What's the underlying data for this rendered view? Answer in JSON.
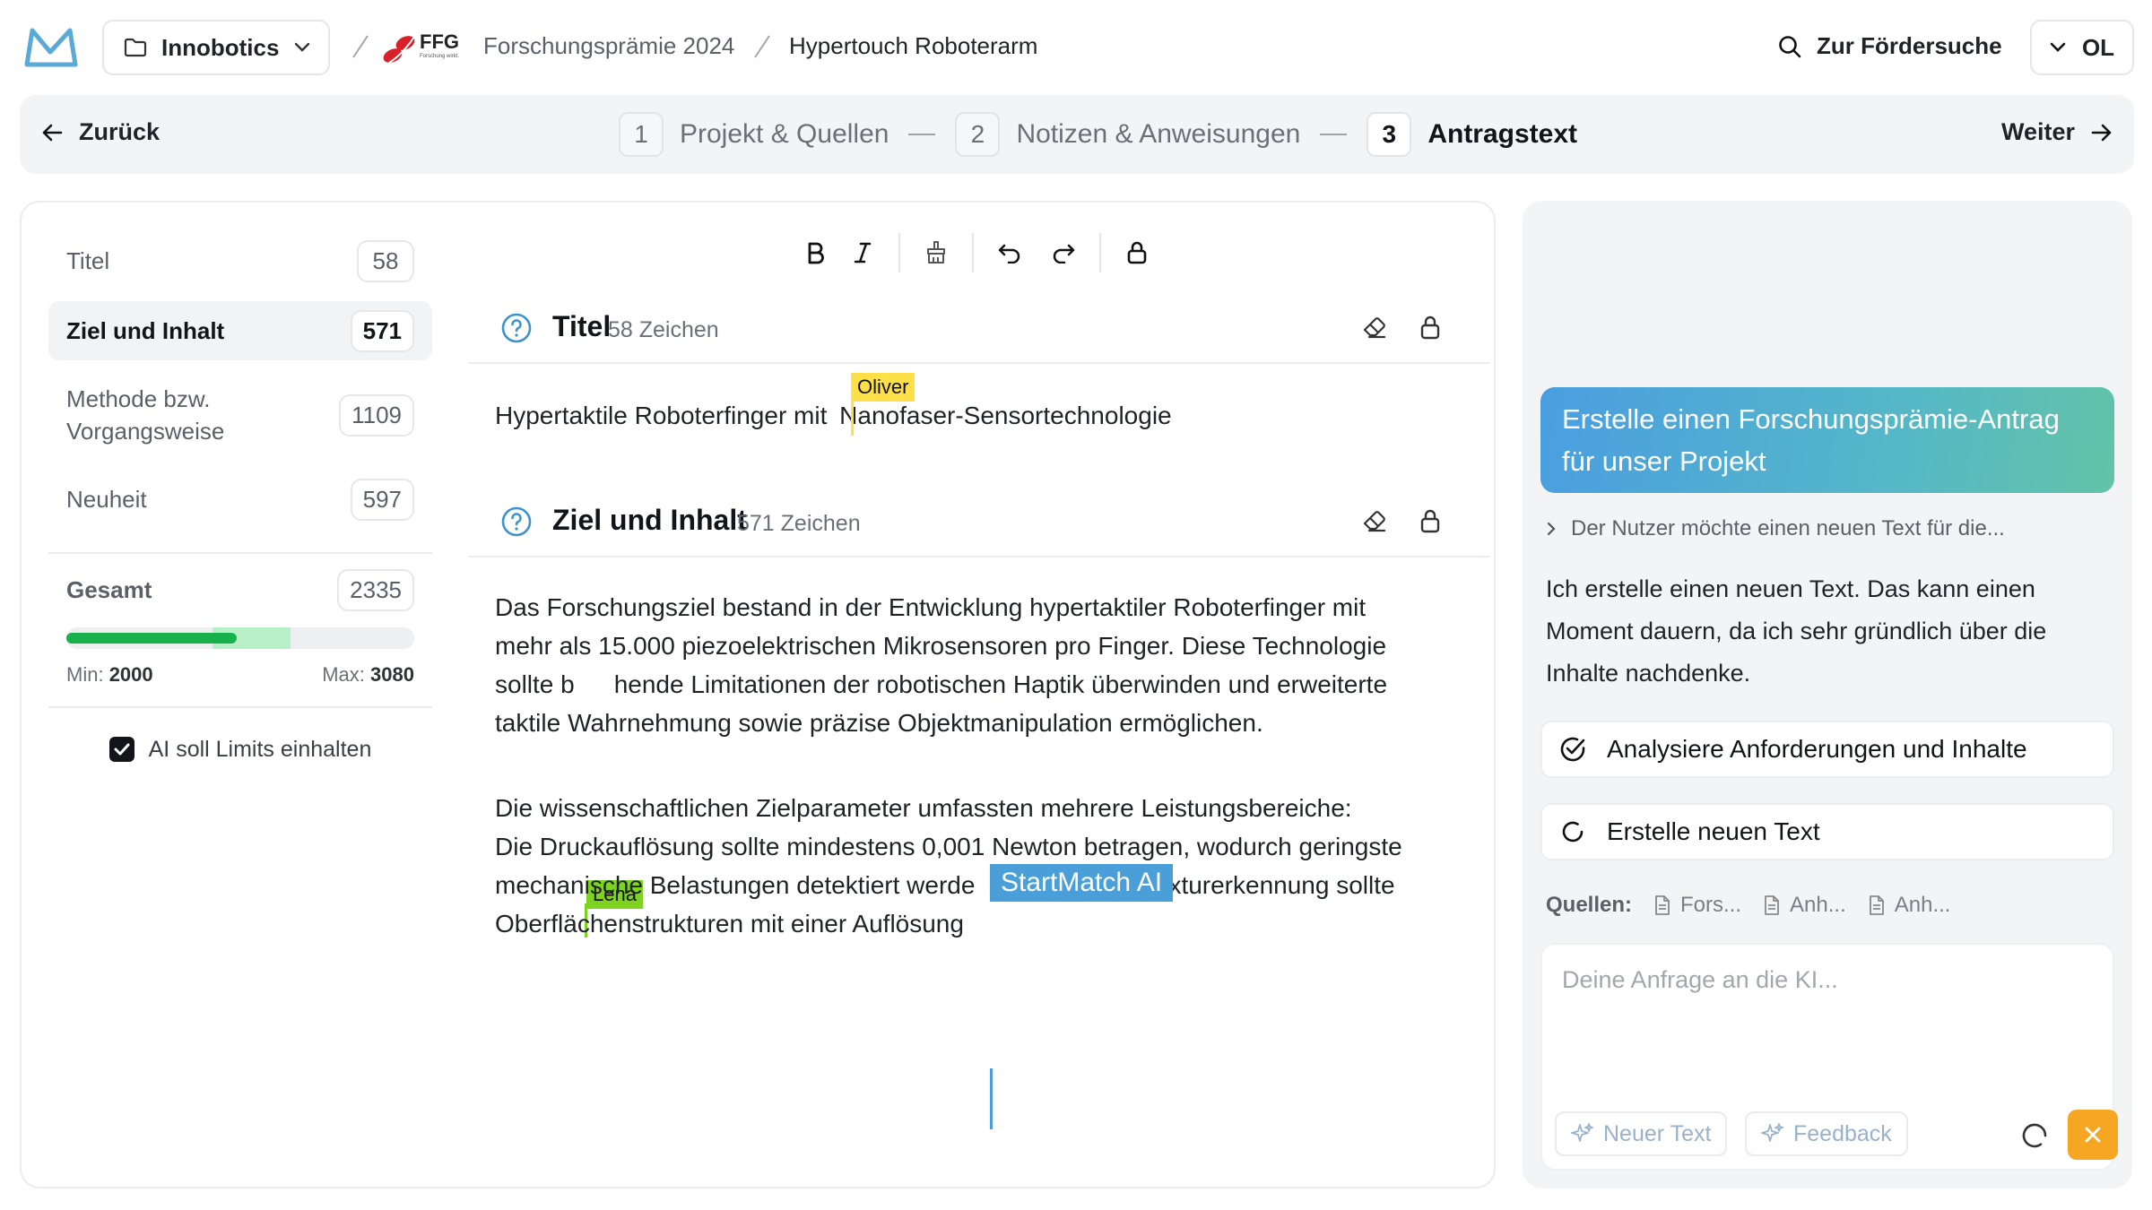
{
  "header": {
    "workspace": "Innobotics",
    "funder_logo": "FFG",
    "breadcrumb_program": "Forschungsprämie 2024",
    "breadcrumb_project": "Hypertouch Roboterarm",
    "search_link": "Zur Fördersuche",
    "user_initials": "OL"
  },
  "stepper": {
    "back_label": "Zurück",
    "next_label": "Weiter",
    "steps": [
      {
        "num": "1",
        "label": "Projekt & Quellen"
      },
      {
        "num": "2",
        "label": "Notizen & Anweisungen"
      },
      {
        "num": "3",
        "label": "Antragstext"
      }
    ],
    "active_step": 3
  },
  "sidebar": {
    "sections": [
      {
        "label": "Titel",
        "count": "58"
      },
      {
        "label": "Ziel und Inhalt",
        "count": "571",
        "active": true
      },
      {
        "label": "Methode bzw.\nVorgangsweise",
        "label_line1": "Methode bzw.",
        "label_line2": "Vorgangsweise",
        "count": "1109"
      },
      {
        "label": "Neuheit",
        "count": "597"
      }
    ],
    "total_label": "Gesamt",
    "total_count": "2335",
    "min_label": "Min:",
    "min_value": "2000",
    "max_label": "Max:",
    "max_value": "3080",
    "progress": {
      "current": 2335,
      "min": 2000,
      "max": 3080
    },
    "limit_checkbox_label": "AI soll Limits einhalten",
    "limit_checked": true
  },
  "toolbar": {
    "buttons": [
      "bold-icon",
      "italic-icon",
      "paint-brush-icon",
      "undo-icon",
      "redo-icon",
      "lock-icon"
    ]
  },
  "editor": {
    "title_section": {
      "heading": "Titel",
      "count_text": "58 Zeichen",
      "text_before": "Hypertaktile Roboterfinger mit",
      "text_after": "Nanofaser-Sensortechnologie",
      "cursor_user": "Oliver"
    },
    "goal_section": {
      "heading": "Ziel und Inhalt",
      "count_text": "571 Zeichen",
      "p1_line1": "Das Forschungsziel bestand in der Entwicklung hypertaktiler Roboterfinger mit",
      "p1_line2": "mehr als 15.000 piezoelektrischen Mikrosensoren pro Finger. Diese Technologie",
      "p1_line3a": "sollte b",
      "p1_line3b": "hende Limitationen der robotischen Haptik überwinden und erweiterte",
      "p1_line4a": "taktile",
      "p1_line4b": "Wahrnehmung sowie präzise Objektmanipulation ermöglichen.",
      "p2_line1": "Die wissenschaftlichen Zielparameter umfassten mehrere Leistungsbereiche:",
      "p2_line2": "Die Druckauflösung sollte mindestens 0,001 Newton betragen, wodurch geringste",
      "p2_line3a": "mechanische Belastungen detektiert werde",
      "p2_line3b": "xturerkennung sollte",
      "p2_line4": "Oberflächenstrukturen mit einer Auflösung",
      "cursor_user_lena": "Lena",
      "cursor_ai": "StartMatch AI"
    },
    "colors": {
      "oliver": "#fde047",
      "lena": "#7ed321",
      "ai": "#4a9fd8"
    }
  },
  "ai_panel": {
    "prompt": "Erstelle einen Forschungsprämie-Antrag für unser Projekt",
    "prompt_line1": "Erstelle einen Forschungsprämie-Antrag",
    "prompt_line2": "für unser Projekt",
    "thinking": "Der Nutzer möchte einen neuen Text für die...",
    "response_line1": "Ich erstelle einen neuen Text. Das kann einen",
    "response_line2": "Moment dauern, da ich sehr gründlich über die",
    "response_line3": "Inhalte nachdenke.",
    "tasks": [
      {
        "label": "Analysiere Anforderungen und Inhalte",
        "status": "done"
      },
      {
        "label": "Erstelle neuen Text",
        "status": "running"
      }
    ],
    "sources_label": "Quellen:",
    "sources": [
      "Fors...",
      "Anh...",
      "Anh..."
    ],
    "input_placeholder": "Deine Anfrage an die KI...",
    "new_text_button": "Neuer Text",
    "feedback_button": "Feedback"
  }
}
